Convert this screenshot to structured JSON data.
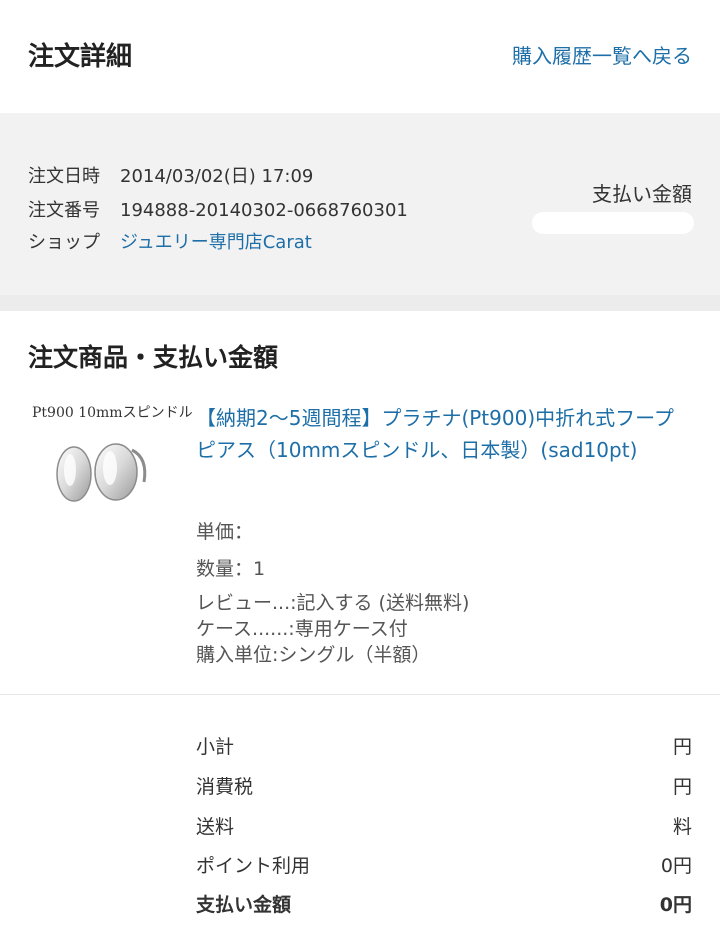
{
  "header": {
    "title": "注文詳細",
    "back_link": "購入履歴一覧へ戻る"
  },
  "order": {
    "date_label": "注文日時",
    "date_value": "2014/03/02(日) 17:09",
    "number_label": "注文番号",
    "number_value": "194888-20140302-0668760301",
    "shop_label": "ショップ",
    "shop_value": "ジュエリー専門店Carat",
    "payment_label": "支払い金額"
  },
  "products_section": {
    "title": "注文商品・支払い金額",
    "item": {
      "thumbnail_caption": "Pt900 10mmスピンドル",
      "name": "【納期2〜5週間程】プラチナ(Pt900)中折れ式フープピアス（10mmスピンドル、日本製）(sad10pt)",
      "price_label": "単価：",
      "quantity_label": "数量：",
      "quantity_value": "1",
      "options": [
        "レビュー...:記入する (送料無料)",
        "ケース......:専用ケース付",
        "購入単位:シングル（半額）"
      ]
    }
  },
  "summary": {
    "rows": [
      {
        "label": "小計",
        "value": "円"
      },
      {
        "label": "消費税",
        "value": "円"
      },
      {
        "label": "送料",
        "value": "料"
      },
      {
        "label": "ポイント利用",
        "value": "0円"
      },
      {
        "label": "支払い金額",
        "value": "0円"
      }
    ]
  },
  "colors": {
    "link": "#1e6fa8",
    "info_background": "#f2f2f2"
  }
}
